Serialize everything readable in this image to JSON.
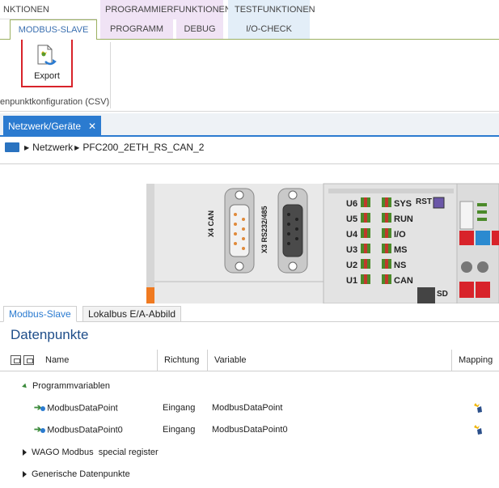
{
  "ribbon": {
    "groups": [
      "NKTIONEN",
      "PROGRAMMIERFUNKTIONEN",
      "TESTFUNKTIONEN"
    ],
    "tabs": [
      "MODBUS-SLAVE",
      "PROGRAMM",
      "DEBUG",
      "I/O-CHECK"
    ],
    "export_label": "Export",
    "group_caption": "enpunktkonfiguration (CSV)"
  },
  "document_tab": {
    "label": "Netzwerk/Geräte",
    "close": "✕"
  },
  "breadcrumb": {
    "items": [
      "Netzwerk",
      "PFC200_2ETH_RS_CAN_2"
    ]
  },
  "device": {
    "port_labels": [
      "X4 CAN",
      "X3 RS232/485"
    ],
    "left_leds": [
      "U6",
      "U5",
      "U4",
      "U3",
      "U2",
      "U1"
    ],
    "right_leds": [
      "SYS",
      "RUN",
      "I/O",
      "MS",
      "NS",
      "CAN"
    ],
    "rst_label": "RST",
    "sd_label": "SD"
  },
  "bottom_tabs": [
    "Modbus-Slave",
    "Lokalbus E/A-Abbild"
  ],
  "section_title": "Datenpunkte",
  "table": {
    "headers": [
      "Name",
      "Richtung",
      "Variable",
      "Mapping"
    ],
    "groups": [
      {
        "label": "Programmvariablen",
        "expanded": true
      },
      {
        "label": "WAGO Modbus  special register",
        "expanded": false
      },
      {
        "label": "Generische Datenpunkte",
        "expanded": false
      }
    ],
    "rows": [
      {
        "name": "ModbusDataPoint",
        "direction": "Eingang",
        "variable": "ModbusDataPoint"
      },
      {
        "name": "ModbusDataPoint0",
        "direction": "Eingang",
        "variable": "ModbusDataPoint0"
      }
    ]
  },
  "colors": {
    "accent": "#2b7bd0",
    "highlight": "#d8232a",
    "ribbon_line": "#9bb060"
  }
}
